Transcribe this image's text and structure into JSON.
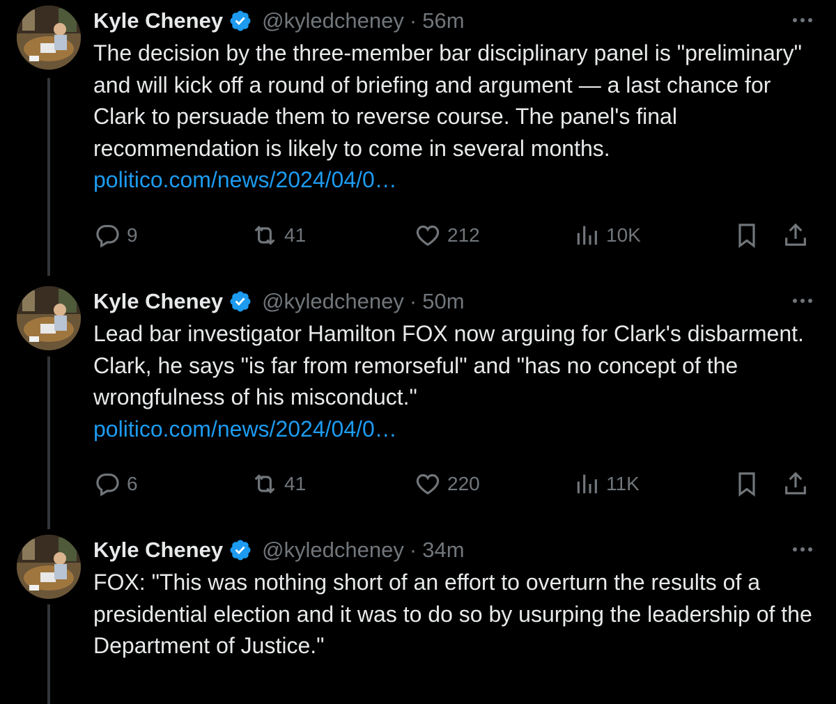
{
  "author": {
    "name": "Kyle Cheney",
    "handle": "@kyledcheney"
  },
  "separator": "·",
  "tweets": [
    {
      "time": "56m",
      "text": "The decision by the three-member bar disciplinary panel is \"preliminary\" and will kick off a round of briefing and argument — a last chance for Clark to persuade them to reverse course. The panel's final recommendation is likely to come in several months.",
      "link": "politico.com/news/2024/04/0…",
      "replies": "9",
      "reposts": "41",
      "likes": "212",
      "views": "10K"
    },
    {
      "time": "50m",
      "text": "Lead bar investigator Hamilton FOX now arguing for Clark's disbarment. Clark, he says \"is far from remorseful\" and \"has no concept of the wrongfulness of his misconduct.\"",
      "link": "politico.com/news/2024/04/0…",
      "replies": "6",
      "reposts": "41",
      "likes": "220",
      "views": "11K"
    },
    {
      "time": "34m",
      "text": "FOX: \"This was nothing short of an effort to overturn the results of a presidential election and it was to do so by usurping the leadership of the Department of Justice.\""
    }
  ],
  "icons": {
    "verified": "verified-badge-icon",
    "more": "more-options-icon",
    "reply": "reply-icon",
    "repost": "repost-icon",
    "like": "like-heart-icon",
    "views": "views-chart-icon",
    "bookmark": "bookmark-icon",
    "share": "share-icon"
  },
  "colors": {
    "background": "#000000",
    "text": "#e7e9ea",
    "muted": "#71767b",
    "link": "#1d9bf0",
    "verified": "#1d9bf0"
  }
}
